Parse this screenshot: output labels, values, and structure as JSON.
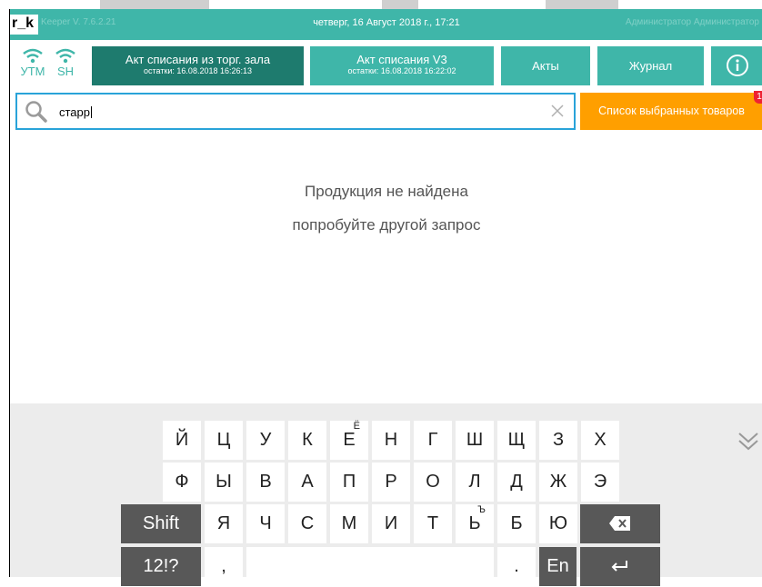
{
  "titlebar": {
    "logo": "r_k",
    "version": "Keeper V. 7.6.2.21",
    "datetime": "четверг, 16 Август 2018 г., 17:21",
    "user": "Администратор Администратор"
  },
  "status": {
    "utm": "УТМ",
    "sh": "SH"
  },
  "toolbar": {
    "act_hall": {
      "title": "Акт списания из торг. зала",
      "subtitle": "остатки: 16.08.2018 16:26:13"
    },
    "act_v3": {
      "title": "Акт списания V3",
      "subtitle": "остатки: 16.08.2018 16:22:02"
    },
    "acts": "Акты",
    "journal": "Журнал"
  },
  "search": {
    "value": "старр"
  },
  "selected_list": {
    "label": "Список выбранных товаров",
    "badge": "1"
  },
  "empty_state": {
    "title": "Продукция не найдена",
    "hint": "попробуйте другой запрос"
  },
  "keyboard": {
    "row1": [
      "Й",
      "Ц",
      "У",
      "К",
      "Е",
      "Н",
      "Г",
      "Ш",
      "Щ",
      "З",
      "Х"
    ],
    "row1_alt_e": "Ё",
    "row2": [
      "Ф",
      "Ы",
      "В",
      "А",
      "П",
      "Р",
      "О",
      "Л",
      "Д",
      "Ж",
      "Э"
    ],
    "row3": [
      "Я",
      "Ч",
      "С",
      "М",
      "И",
      "Т",
      "Ь",
      "Б",
      "Ю"
    ],
    "row3_alt_soft": "Ъ",
    "shift": "Shift",
    "symbols": "12!?",
    "comma": ",",
    "period": ".",
    "lang": "En"
  },
  "colors": {
    "teal": "#3fb6a9",
    "dark_teal": "#1e7b6e",
    "orange": "#ff9f00",
    "search_border": "#29a3d9"
  }
}
